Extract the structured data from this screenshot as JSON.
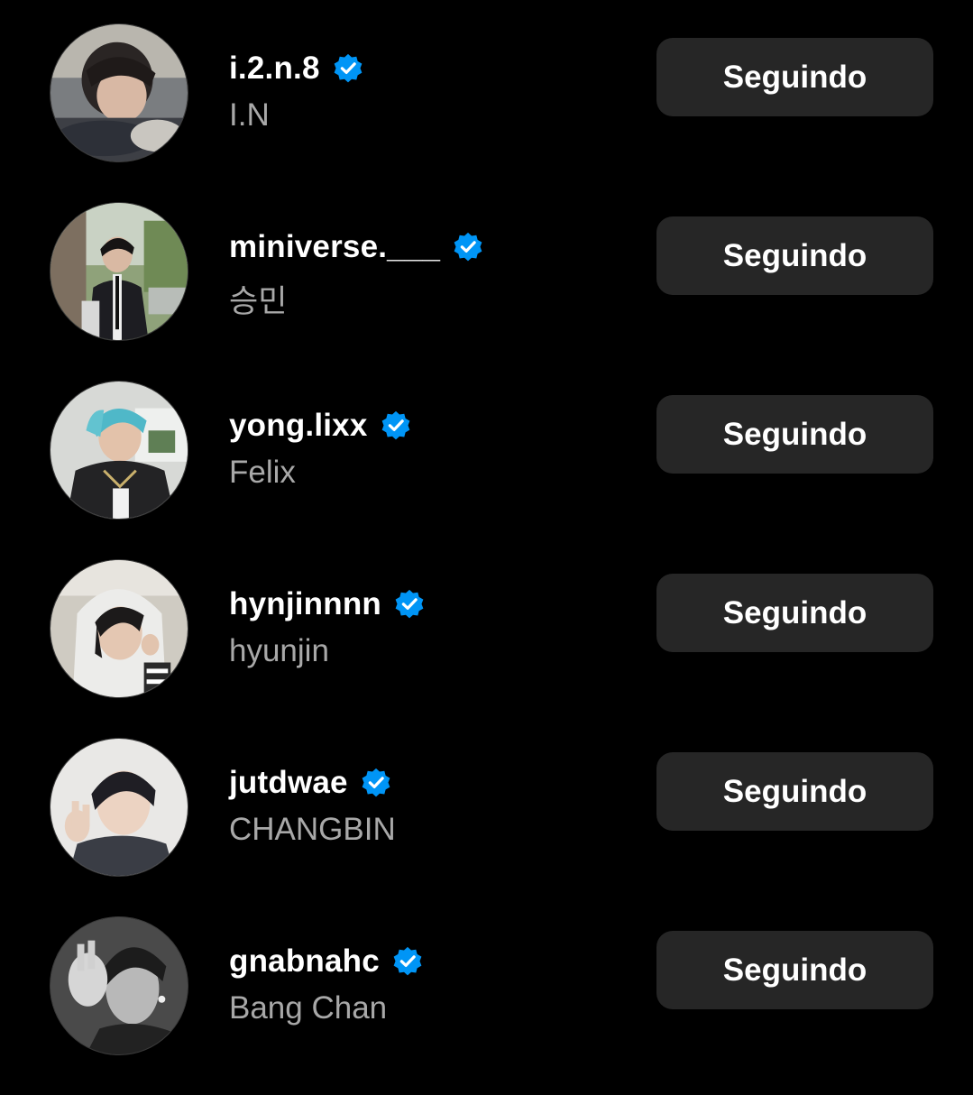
{
  "accounts": [
    {
      "username": "i.2.n.8",
      "full_name": "I.N",
      "verified": true,
      "verified_icon": "verified-badge-icon",
      "button_label": "Seguindo"
    },
    {
      "username": "miniverse.___",
      "full_name": "승민",
      "verified": true,
      "verified_icon": "verified-badge-icon",
      "button_label": "Seguindo"
    },
    {
      "username": "yong.lixx",
      "full_name": "Felix",
      "verified": true,
      "verified_icon": "verified-badge-icon",
      "button_label": "Seguindo"
    },
    {
      "username": "hynjinnnn",
      "full_name": "hyunjin",
      "verified": true,
      "verified_icon": "verified-badge-icon",
      "button_label": "Seguindo"
    },
    {
      "username": "jutdwae",
      "full_name": "CHANGBIN",
      "verified": true,
      "verified_icon": "verified-badge-icon",
      "button_label": "Seguindo"
    },
    {
      "username": "gnabnahc",
      "full_name": "Bang Chan",
      "verified": true,
      "verified_icon": "verified-badge-icon",
      "button_label": "Seguindo"
    }
  ],
  "colors": {
    "background": "#000000",
    "username_text": "#ffffff",
    "full_name_text": "#a8a8a8",
    "button_background": "#262626",
    "button_text": "#ffffff",
    "verified_blue": "#0095f6"
  }
}
